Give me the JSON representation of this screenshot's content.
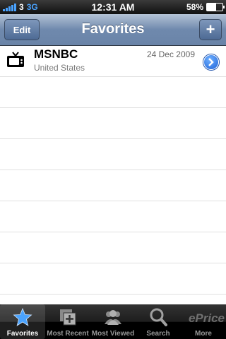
{
  "status": {
    "carrier": "3",
    "network": "3G",
    "time": "12:31 AM",
    "battery": "58%",
    "battery_level": 0.58
  },
  "nav": {
    "edit_label": "Edit",
    "title": "Favorites",
    "add_label": "+"
  },
  "favorites": [
    {
      "name": "MSNBC",
      "region": "United States",
      "date": "24 Dec 2009",
      "icon": "tv-icon"
    }
  ],
  "tabs": [
    {
      "label": "Favorites",
      "icon": "star-icon",
      "active": true
    },
    {
      "label": "Most Recent",
      "icon": "recent-icon",
      "active": false
    },
    {
      "label": "Most Viewed",
      "icon": "people-icon",
      "active": false
    },
    {
      "label": "Search",
      "icon": "search-icon",
      "active": false
    },
    {
      "label": "More",
      "icon": "more-icon",
      "active": false
    }
  ],
  "watermark": "ePrice",
  "colors": {
    "accent": "#1f63d8",
    "nav_gradient": "#6f89ad"
  }
}
